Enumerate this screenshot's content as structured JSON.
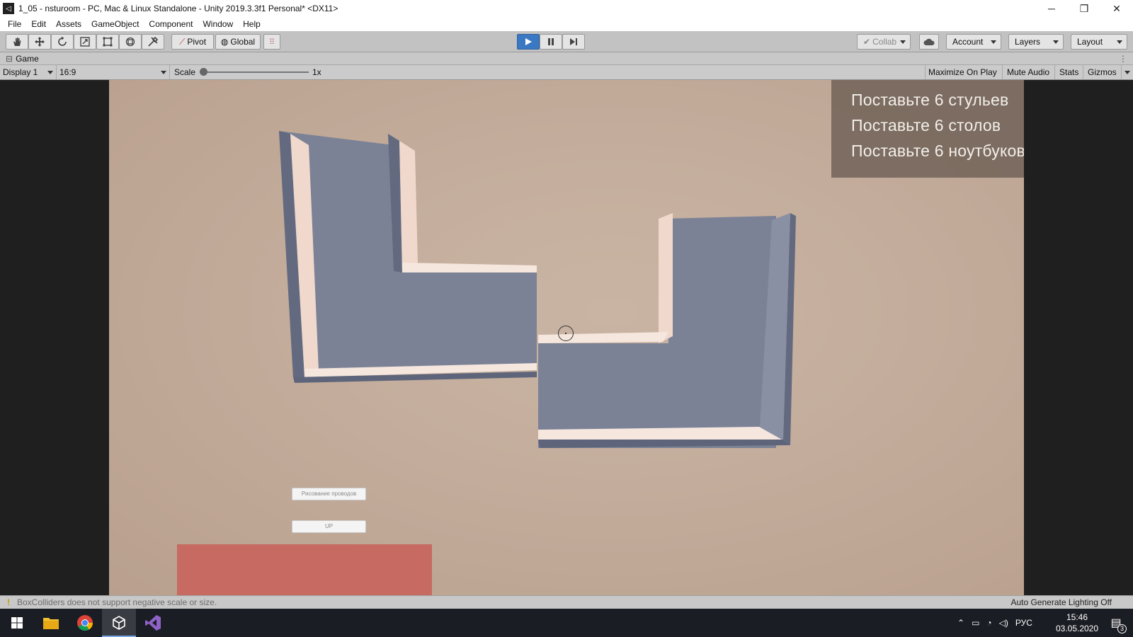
{
  "window": {
    "title": "1_05 - nsturoom - PC, Mac & Linux Standalone - Unity 2019.3.3f1 Personal* <DX11>",
    "minimize": "─",
    "restore": "❐",
    "close": "✕"
  },
  "menu": [
    "File",
    "Edit",
    "Assets",
    "GameObject",
    "Component",
    "Window",
    "Help"
  ],
  "toolbar": {
    "pivot": "Pivot",
    "global": "Global",
    "collab": "Collab",
    "account": "Account",
    "layers": "Layers",
    "layout": "Layout"
  },
  "game_tab": {
    "label": "Game"
  },
  "game_bar": {
    "display": "Display 1",
    "aspect": "16:9",
    "scale_label": "Scale",
    "scale_value": "1x",
    "maximize": "Maximize On Play",
    "mute": "Mute Audio",
    "stats": "Stats",
    "gizmos": "Gizmos"
  },
  "scene": {
    "tasks": [
      "Поставьте 6 стульев",
      "Поставьте 6 столов",
      "Поставьте 6 ноутбуков"
    ],
    "button_wires": "Рисование проводов",
    "button_up": "UP"
  },
  "status": {
    "message": "BoxColliders does not support negative scale or size.",
    "lighting": "Auto Generate Lighting Off"
  },
  "taskbar": {
    "lang": "РУС",
    "time": "15:46",
    "date": "03.05.2020",
    "notifications": "3"
  },
  "colors": {
    "play_active": "#3b78c4",
    "red_panel": "#c76a62",
    "task_panel": "#73645a"
  }
}
